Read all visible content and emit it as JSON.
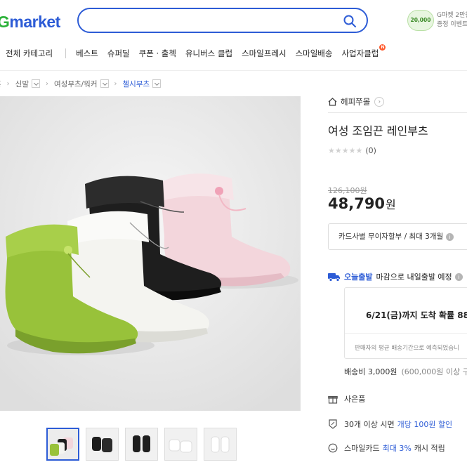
{
  "header": {
    "logo_prefix": "G",
    "logo_text": "market",
    "search_placeholder": "",
    "promo_badge": "20,000",
    "promo_line1": "G마켓 2만원",
    "promo_line2": "증정 이벤트"
  },
  "nav": {
    "all_categories": "전체 카테고리",
    "items": [
      "베스트",
      "슈퍼딜",
      "쿠폰 · 출첵",
      "유니버스 클럽",
      "스마일프레시",
      "스마일배송",
      "사업자클럽"
    ],
    "new_badge": "N"
  },
  "breadcrumb": {
    "items": [
      "홈",
      "신발",
      "여성부츠/워커",
      "첼시부츠"
    ]
  },
  "product": {
    "shop_name": "헤피쭈몰",
    "title": "여성 조임끈 레인부츠",
    "rating_stars": "★★★★★",
    "review_count": "(0)",
    "original_price": "126,100원",
    "price": "48,790",
    "currency": "원",
    "card_installment": "카드사별 무이자할부 / 최대 3개월"
  },
  "delivery": {
    "today_label": "오늘출발",
    "today_text": "마감으로 내일출발 예정",
    "eta": "6/21(금)까지 도착 확률 88",
    "eta_note": "판매자의 평균 배송기간으로 예측되었습니",
    "fee": "배송비 3,000원",
    "fee_condition": "(600,000원 이상 구"
  },
  "benefits": {
    "gift": "사은품",
    "bulk_prefix": "30개 이상 시면",
    "bulk_highlight": "개당 100원 할인",
    "smilecard_prefix": "스마일카드",
    "smilecard_highlight": "최대 3%",
    "smilecard_suffix": "캐시 적립"
  },
  "colors": {
    "brand_blue": "#2d5cd6",
    "brand_green": "#2cb23a",
    "boot_green": "#98c23a",
    "boot_white": "#f4f4f0",
    "boot_black": "#1e1e1e",
    "boot_pink": "#f3d6dc"
  }
}
